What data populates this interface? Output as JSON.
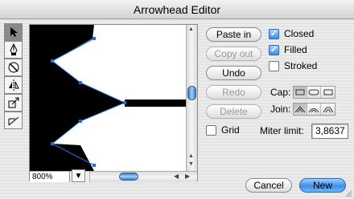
{
  "window": {
    "title": "Arrowhead Editor"
  },
  "tools": [
    {
      "name": "arrow-select-tool-icon",
      "active": true
    },
    {
      "name": "pen-tool-icon",
      "active": false
    },
    {
      "name": "delete-point-tool-icon",
      "active": false
    },
    {
      "name": "flip-tool-icon",
      "active": false
    },
    {
      "name": "scale-tool-icon",
      "active": false
    },
    {
      "name": "line-tool-icon",
      "active": false
    }
  ],
  "canvas": {
    "zoom": "800%",
    "fill_color": "#000000",
    "handle_color": "#1f6fd1"
  },
  "buttons": {
    "paste_in": "Paste in",
    "copy_out": "Copy out",
    "undo": "Undo",
    "redo": "Redo",
    "delete": "Delete",
    "cancel": "Cancel",
    "new": "New"
  },
  "options": {
    "closed": {
      "label": "Closed",
      "checked": true
    },
    "filled": {
      "label": "Filled",
      "checked": true
    },
    "stroked": {
      "label": "Stroked",
      "checked": false
    },
    "grid": {
      "label": "Grid",
      "checked": false
    }
  },
  "cap": {
    "label": "Cap:",
    "options": [
      "butt",
      "round",
      "square"
    ],
    "selected": 0
  },
  "join": {
    "label": "Join:",
    "options": [
      "miter",
      "round",
      "bevel"
    ],
    "selected": 0
  },
  "miter": {
    "label": "Miter limit:",
    "value": "3,8637"
  },
  "colors": {
    "accent": "#3c8fe8",
    "disabled_text": "#9a9a9a"
  }
}
